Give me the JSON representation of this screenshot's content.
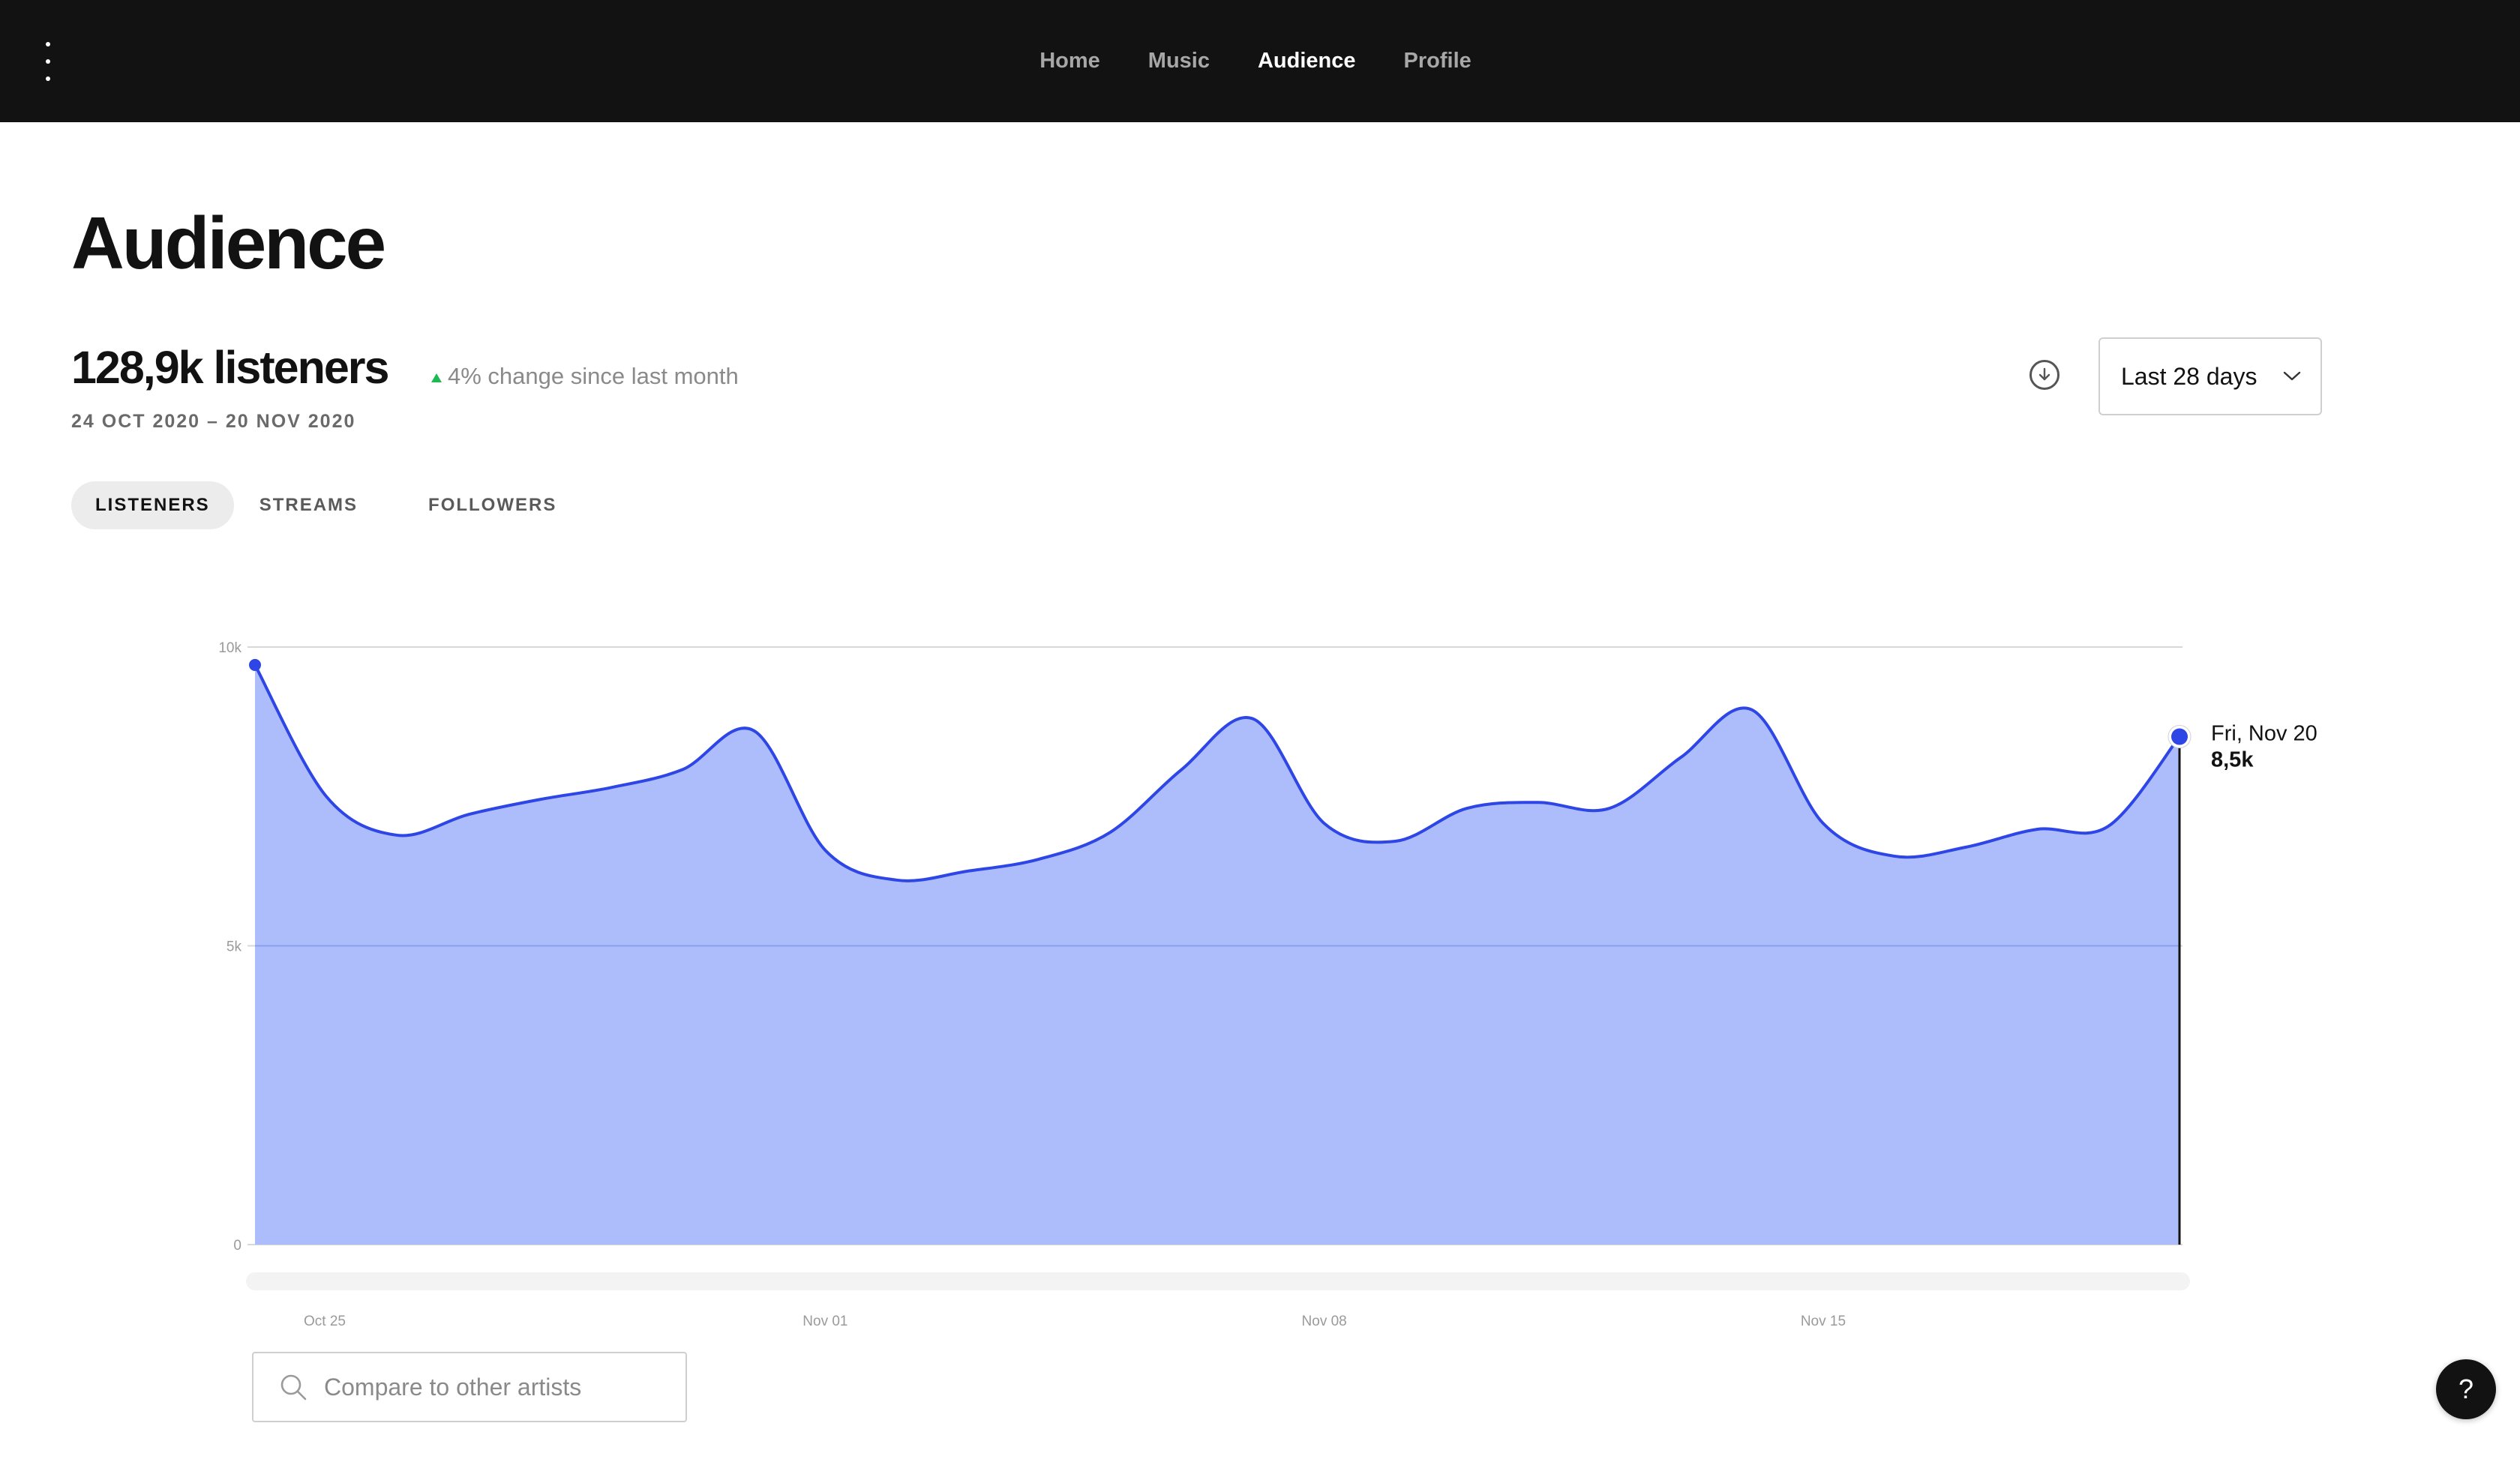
{
  "nav": {
    "items": [
      {
        "label": "Home",
        "active": false
      },
      {
        "label": "Music",
        "active": false
      },
      {
        "label": "Audience",
        "active": true
      },
      {
        "label": "Profile",
        "active": false
      }
    ]
  },
  "page": {
    "title": "Audience",
    "listeners": "128,9k listeners",
    "change": "4% change since last month",
    "date_range": "24 OCT 2020 – 20 NOV 2020",
    "range_select": "Last 28 days"
  },
  "tabs": [
    {
      "label": "LISTENERS",
      "active": true
    },
    {
      "label": "STREAMS",
      "active": false
    },
    {
      "label": "FOLLOWERS",
      "active": false
    }
  ],
  "search": {
    "placeholder": "Compare to other artists"
  },
  "help": {
    "label": "?"
  },
  "icons": {
    "menu": "vertical-dots-icon",
    "download": "download-icon",
    "dropdown": "chevron-down-icon",
    "search": "search-icon"
  },
  "colors": {
    "accent": "#2d46e5",
    "area_fill": "#adbdfc",
    "up": "#1db954"
  },
  "chart_data": {
    "type": "area",
    "x": [
      "Oct 24",
      "Oct 25",
      "Oct 26",
      "Oct 27",
      "Oct 28",
      "Oct 29",
      "Oct 30",
      "Oct 31",
      "Nov 01",
      "Nov 02",
      "Nov 03",
      "Nov 04",
      "Nov 05",
      "Nov 06",
      "Nov 07",
      "Nov 08",
      "Nov 09",
      "Nov 10",
      "Nov 11",
      "Nov 12",
      "Nov 13",
      "Nov 14",
      "Nov 15",
      "Nov 16",
      "Nov 17",
      "Nov 18",
      "Nov 19",
      "Nov 20"
    ],
    "values": [
      9700,
      7500,
      6850,
      7200,
      7450,
      7650,
      7950,
      8600,
      6600,
      6100,
      6250,
      6450,
      6900,
      7950,
      8800,
      7050,
      6750,
      7300,
      7400,
      7300,
      8150,
      8950,
      7050,
      6500,
      6650,
      6950,
      7000,
      8500
    ],
    "yticks": [
      {
        "value": 0,
        "label": "0"
      },
      {
        "value": 5000,
        "label": "5k"
      },
      {
        "value": 10000,
        "label": "10k"
      }
    ],
    "xticks": [
      {
        "index": 1,
        "label": "Oct 25"
      },
      {
        "index": 8,
        "label": "Nov 01"
      },
      {
        "index": 15,
        "label": "Nov 08"
      },
      {
        "index": 22,
        "label": "Nov 15"
      }
    ],
    "ylim": [
      0,
      10000
    ],
    "grid": true,
    "tooltip": {
      "index": 27,
      "date": "Fri, Nov 20",
      "value": "8,5k"
    }
  }
}
